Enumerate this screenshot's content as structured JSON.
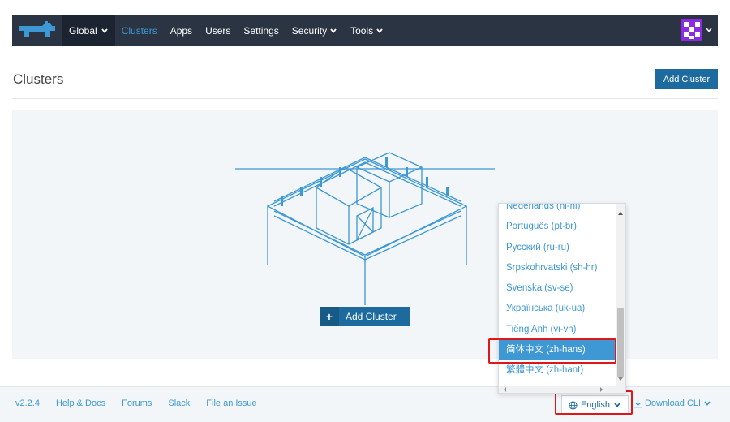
{
  "nav": {
    "global": "Global",
    "items": [
      {
        "label": "Clusters",
        "active": true,
        "dropdown": false
      },
      {
        "label": "Apps",
        "active": false,
        "dropdown": false
      },
      {
        "label": "Users",
        "active": false,
        "dropdown": false
      },
      {
        "label": "Settings",
        "active": false,
        "dropdown": false
      },
      {
        "label": "Security",
        "active": false,
        "dropdown": true
      },
      {
        "label": "Tools",
        "active": false,
        "dropdown": true
      }
    ]
  },
  "header": {
    "title": "Clusters",
    "add_button": "Add Cluster"
  },
  "empty_state": {
    "add_button": "Add Cluster"
  },
  "footer": {
    "version": "v2.2.4",
    "links": [
      "Help & Docs",
      "Forums",
      "Slack",
      "File an Issue"
    ],
    "language": "English",
    "download": "Download CLI"
  },
  "language_menu": {
    "items": [
      {
        "label": "Nederlands (nl-nl)",
        "selected": false
      },
      {
        "label": "Português (pt-br)",
        "selected": false
      },
      {
        "label": "Русский (ru-ru)",
        "selected": false
      },
      {
        "label": "Srpskohrvatski (sh-hr)",
        "selected": false
      },
      {
        "label": "Svenska (sv-se)",
        "selected": false
      },
      {
        "label": "Українська (uk-ua)",
        "selected": false
      },
      {
        "label": "Tiếng Anh (vi-vn)",
        "selected": false
      },
      {
        "label": "简体中文 (zh-hans)",
        "selected": true
      },
      {
        "label": "繁體中文 (zh-hant)",
        "selected": false
      }
    ]
  },
  "colors": {
    "nav_bg": "#2b3442",
    "accent": "#3d98d3",
    "primary_button": "#1c6a9e",
    "highlight": "#e0161b"
  }
}
